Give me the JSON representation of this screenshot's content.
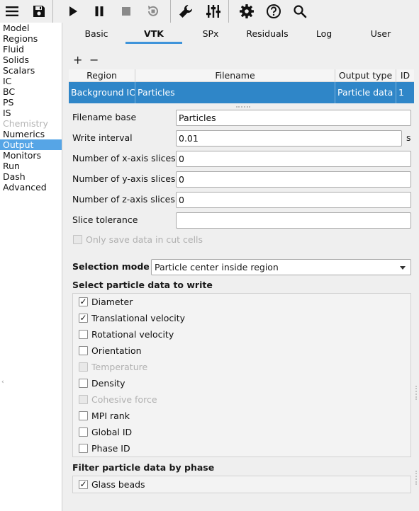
{
  "toolbar": {
    "icons": [
      "menu-icon",
      "save-icon",
      "play-icon",
      "pause-icon",
      "stop-icon",
      "reset-icon",
      "wrench-icon",
      "sliders-icon",
      "gear-icon",
      "help-icon",
      "search-icon"
    ]
  },
  "nav": {
    "items": [
      {
        "label": "Model"
      },
      {
        "label": "Regions"
      },
      {
        "label": "Fluid"
      },
      {
        "label": "Solids"
      },
      {
        "label": "Scalars"
      },
      {
        "label": "IC"
      },
      {
        "label": "BC"
      },
      {
        "label": "PS"
      },
      {
        "label": "IS"
      },
      {
        "label": "Chemistry",
        "disabled": true
      },
      {
        "label": "Numerics"
      },
      {
        "label": "Output",
        "selected": true
      },
      {
        "label": "Monitors"
      },
      {
        "label": "Run"
      },
      {
        "label": "Dash"
      },
      {
        "label": "Advanced"
      }
    ]
  },
  "tabs": {
    "items": [
      "Basic",
      "VTK",
      "SPx",
      "Residuals",
      "Log",
      "User"
    ],
    "active": "VTK"
  },
  "table_actions": {
    "add": "+",
    "remove": "−"
  },
  "table": {
    "headers": [
      "Region",
      "Filename",
      "Output type",
      "ID"
    ],
    "rows": [
      {
        "region": "Background IC",
        "filename": "Particles",
        "output_type": "Particle data",
        "id": "1"
      }
    ]
  },
  "form": {
    "filename_base": {
      "label": "Filename base",
      "value": "Particles"
    },
    "write_interval": {
      "label": "Write interval",
      "value": "0.01",
      "unit": "s"
    },
    "x_slices": {
      "label": "Number of x-axis slices",
      "value": "0"
    },
    "y_slices": {
      "label": "Number of y-axis slices",
      "value": "0"
    },
    "z_slices": {
      "label": "Number of z-axis slices",
      "value": "0"
    },
    "slice_tolerance": {
      "label": "Slice tolerance",
      "value": ""
    },
    "cut_cells": {
      "label": "Only save data in cut cells",
      "checked": false,
      "disabled": true
    }
  },
  "selection_mode": {
    "label": "Selection mode",
    "value": "Particle center inside region"
  },
  "particle_data": {
    "title": "Select particle data to write",
    "items": [
      {
        "label": "Diameter",
        "checked": true
      },
      {
        "label": "Translational velocity",
        "checked": true
      },
      {
        "label": "Rotational velocity",
        "checked": false
      },
      {
        "label": "Orientation",
        "checked": false
      },
      {
        "label": "Temperature",
        "checked": false,
        "disabled": true
      },
      {
        "label": "Density",
        "checked": false
      },
      {
        "label": "Cohesive force",
        "checked": false,
        "disabled": true
      },
      {
        "label": "MPI rank",
        "checked": false
      },
      {
        "label": "Global ID",
        "checked": false
      },
      {
        "label": "Phase ID",
        "checked": false
      }
    ]
  },
  "phase_filter": {
    "title": "Filter particle data by phase",
    "items": [
      {
        "label": "Glass beads",
        "checked": true
      }
    ]
  },
  "colors": {
    "selection": "#2f86c8",
    "nav_selected": "#56a5e6",
    "tab_underline": "#3f94da"
  }
}
